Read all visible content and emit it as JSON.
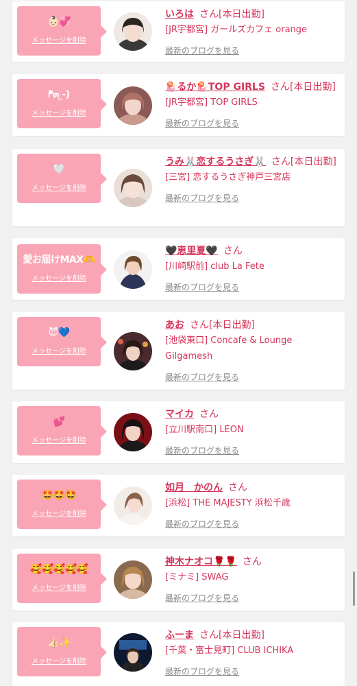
{
  "delete_label": "メッセージを削除",
  "blog_label": "最新のブログを見る",
  "san_label": "さん",
  "accent_color": "#d5355b",
  "bubble_color": "#f9a5b6",
  "items": [
    {
      "message": "👶🏻💞",
      "name": "いろは",
      "status": "[本日出勤]",
      "shop": "[JR宇都宮] ガールズカフェ orange"
    },
    {
      "message": "ᖰ๓ ̫-)",
      "name": "🪼るか🪼TOP GIRLS",
      "status": "[本日出勤]",
      "shop": "[JR宇都宮] TOP GIRLS"
    },
    {
      "message": "🤍",
      "name": "うみ🐰恋するうさぎ🐰",
      "status": "[本日出勤]",
      "shop": "[三宮] 恋するうさぎ神戸三宮店"
    },
    {
      "message": "愛お届けMAX🫶",
      "name": "🖤恵里夏🖤",
      "status": "",
      "shop": "[川崎駅前] club La Fete"
    },
    {
      "message": "😈💙",
      "name": "あお",
      "status": "[本日出勤]",
      "shop": "[池袋東口] Concafe & Lounge Gilgamesh"
    },
    {
      "message": "💕",
      "name": "マイカ",
      "status": "",
      "shop": "[立川駅南口] LEON"
    },
    {
      "message": "🤩🤩🤩",
      "name": "如月　かのん",
      "status": "",
      "shop": "[浜松] THE MAJESTY 浜松千歳"
    },
    {
      "message": "🥰🥰🥰🥰🥰",
      "name": "神木ナオコ🌹🌹",
      "status": "",
      "shop": "[ミナミ] SWAG"
    },
    {
      "message": "👍🏻✨",
      "name": "ふーま",
      "status": "[本日出勤]",
      "shop": "[千葉・富士見町] CLUB ICHIKA"
    }
  ]
}
